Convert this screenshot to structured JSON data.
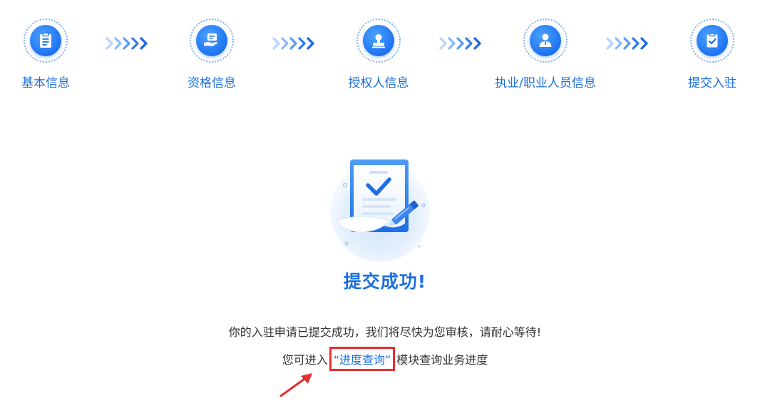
{
  "steps": [
    {
      "label": "基本信息",
      "icon": "clipboard-icon"
    },
    {
      "label": "资格信息",
      "icon": "hand-card-icon"
    },
    {
      "label": "授权人信息",
      "icon": "stamp-icon"
    },
    {
      "label": "执业/职业人员信息",
      "icon": "person-icon"
    },
    {
      "label": "提交入驻",
      "icon": "checklist-icon"
    }
  ],
  "result": {
    "title": "提交成功!",
    "message": "你的入驻申请已提交成功，我们将尽快为您审核，请耐心等待!",
    "hint_prefix": "您可进入",
    "link_text": "“进度查询”",
    "hint_suffix": "模块查询业务进度"
  },
  "colors": {
    "accent": "#1a6fe0",
    "highlight_box": "#e62e2e",
    "text": "#333333"
  }
}
